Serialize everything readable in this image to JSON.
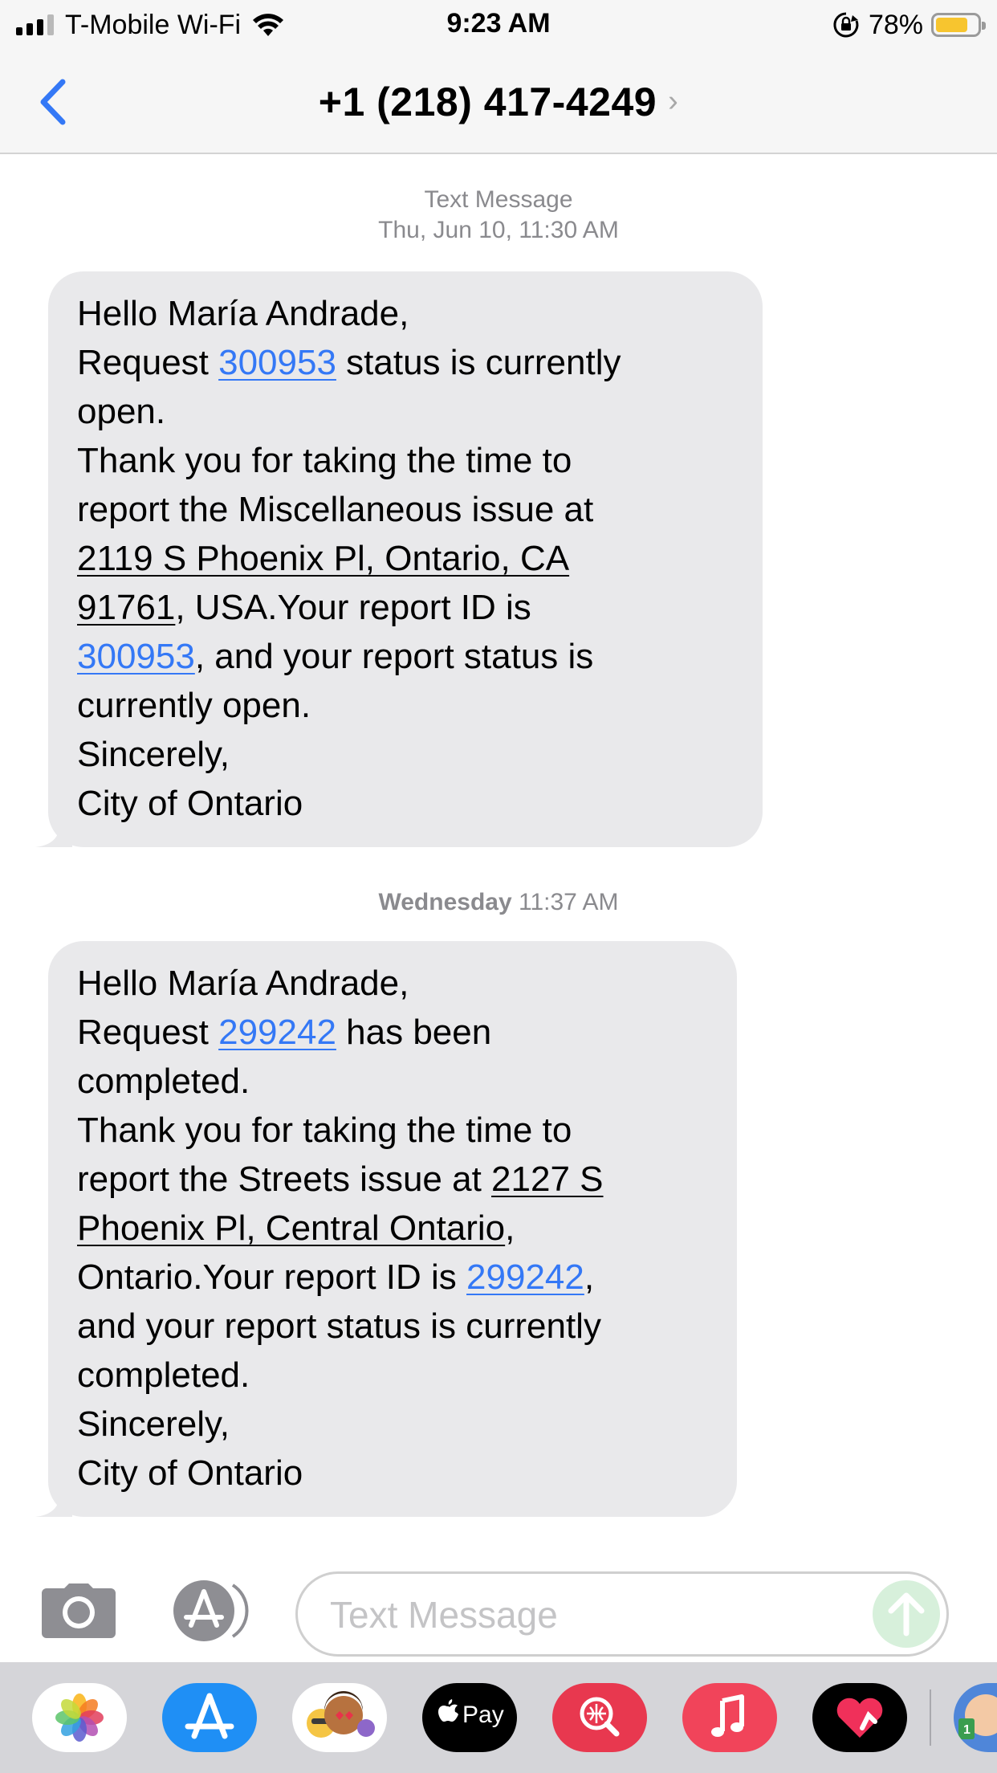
{
  "status_bar": {
    "carrier": "T-Mobile Wi-Fi",
    "time": "9:23 AM",
    "battery_percent": "78%",
    "battery_level": 0.78,
    "battery_color": "#f7c52f",
    "signal_bars_active": 3,
    "signal_bars_total": 4,
    "icons": [
      "signal-icon",
      "wifi-icon",
      "rotation-lock-icon",
      "battery-icon"
    ]
  },
  "nav": {
    "back_icon": "chevron-left-icon",
    "contact": "+1 (218) 417-4249",
    "detail_chevron": "›"
  },
  "conversation": {
    "messages": [
      {
        "timestamp_label": "Text Message",
        "timestamp": "Thu, Jun 10, 11:30 AM",
        "lines": [
          [
            {
              "t": "Hello María Andrade,"
            }
          ],
          [
            {
              "t": "Request "
            },
            {
              "t": "300953",
              "link": "number"
            },
            {
              "t": " status is currently"
            }
          ],
          [
            {
              "t": "open."
            }
          ],
          [
            {
              "t": "Thank you for taking the time to"
            }
          ],
          [
            {
              "t": "report the Miscellaneous issue at"
            }
          ],
          [
            {
              "t": "2119 S Phoenix Pl, Ontario, CA",
              "link": "address"
            }
          ],
          [
            {
              "t": "91761",
              "link": "address"
            },
            {
              "t": ", USA.Your report ID is"
            }
          ],
          [
            {
              "t": "300953",
              "link": "number"
            },
            {
              "t": ", and your report status is"
            }
          ],
          [
            {
              "t": "currently open."
            }
          ],
          [
            {
              "t": "Sincerely,"
            }
          ],
          [
            {
              "t": "City of Ontario"
            }
          ]
        ]
      },
      {
        "timestamp_day": "Wednesday",
        "timestamp": "11:37 AM",
        "lines": [
          [
            {
              "t": "Hello María Andrade,"
            }
          ],
          [
            {
              "t": "Request "
            },
            {
              "t": "299242",
              "link": "number"
            },
            {
              "t": " has been"
            }
          ],
          [
            {
              "t": "completed."
            }
          ],
          [
            {
              "t": "Thank you for taking the time to"
            }
          ],
          [
            {
              "t": "report the Streets issue at "
            },
            {
              "t": "2127 S",
              "link": "address"
            }
          ],
          [
            {
              "t": "Phoenix Pl, Central Ontario",
              "link": "address"
            },
            {
              "t": ","
            }
          ],
          [
            {
              "t": "Ontario.Your report ID is "
            },
            {
              "t": "299242",
              "link": "number"
            },
            {
              "t": ","
            }
          ],
          [
            {
              "t": "and your report status is currently"
            }
          ],
          [
            {
              "t": "completed."
            }
          ],
          [
            {
              "t": "Sincerely,"
            }
          ],
          [
            {
              "t": "City of Ontario"
            }
          ]
        ]
      }
    ]
  },
  "compose": {
    "placeholder": "Text Message",
    "camera_icon": "camera-icon",
    "apps_icon": "app-store-icon",
    "send_icon": "send-arrow-icon",
    "send_color": "#d7f0db"
  },
  "app_drawer": {
    "apps": [
      {
        "name": "photos",
        "icon": "photos-icon"
      },
      {
        "name": "app-store",
        "icon": "app-store-icon"
      },
      {
        "name": "memoji",
        "icon": "memoji-stickers-icon"
      },
      {
        "name": "apple-pay",
        "icon": "apple-pay-icon",
        "label": "Pay"
      },
      {
        "name": "web-images",
        "icon": "image-search-icon"
      },
      {
        "name": "music",
        "icon": "music-icon"
      },
      {
        "name": "digital-touch",
        "icon": "digital-touch-icon"
      },
      {
        "name": "game-avatar",
        "icon": "game-avatar-icon"
      }
    ]
  },
  "colors": {
    "bubble": "#e9e9eb",
    "link": "#3478f6",
    "ios_blue": "#3478f6",
    "bar_bg": "#f6f6f6"
  }
}
